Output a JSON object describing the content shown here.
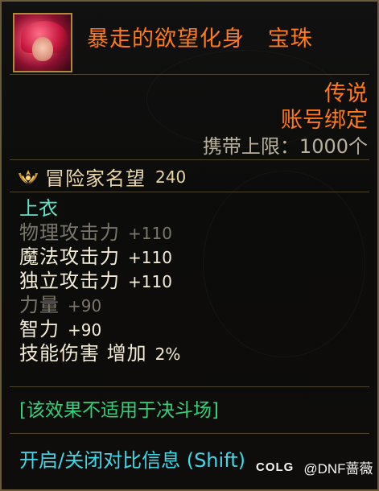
{
  "item": {
    "name": "暴走的欲望化身   宝珠",
    "icon": "character-portrait-icon",
    "rarity": "传说",
    "binding": "账号绑定",
    "carry_limit": "携带上限：1000个"
  },
  "fame": {
    "icon": "laurel-crest-icon",
    "label": "冒险家名望",
    "value": "240"
  },
  "slot": "上衣",
  "stats": [
    {
      "name": "物理攻击力",
      "value": "+110",
      "state": "dim"
    },
    {
      "name": "魔法攻击力",
      "value": "+110",
      "state": "active"
    },
    {
      "name": "独立攻击力",
      "value": "+110",
      "state": "active"
    },
    {
      "name": "力量",
      "value": "+90",
      "state": "dim"
    },
    {
      "name": "智力",
      "value": "+90",
      "state": "active"
    },
    {
      "name": "技能伤害 增加",
      "value": "2%",
      "state": "active"
    }
  ],
  "note": "[该效果不适用于决斗场]",
  "toggle_hint": "开启/关闭对比信息 (Shift)",
  "watermark": {
    "logo": "COLG",
    "handle": "@DNF蔷薇"
  },
  "colors": {
    "item_name": "#ff7a1a",
    "slot": "#5de3c8",
    "note": "#33d07a",
    "toggle": "#42d7e7",
    "border": "#6b5a3a"
  }
}
